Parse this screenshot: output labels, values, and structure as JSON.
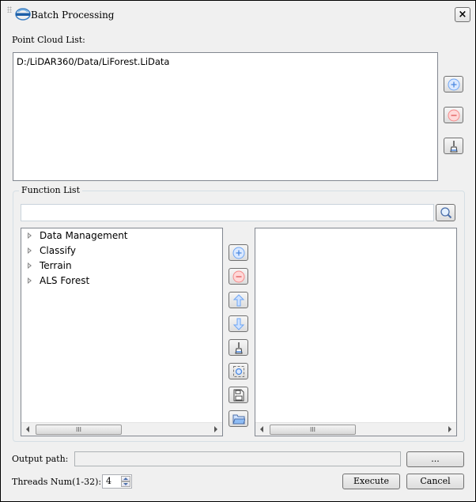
{
  "window": {
    "title": "Batch Processing",
    "close_label": "×"
  },
  "point_cloud": {
    "label": "Point Cloud List:",
    "items": [
      "D:/LiDAR360/Data/LiForest.LiData"
    ]
  },
  "function_list": {
    "label": "Function List",
    "search_placeholder": "",
    "tree": [
      "Data Management",
      "Classify",
      "Terrain",
      "ALS Forest"
    ]
  },
  "scrollbar": {
    "thumb_glyph": "III"
  },
  "output": {
    "label": "Output path:",
    "value": "",
    "browse_label": "..."
  },
  "threads": {
    "label": "Threads Num(1-32):",
    "value": "4"
  },
  "buttons": {
    "execute": "Execute",
    "cancel": "Cancel"
  },
  "colors": {
    "add": "#6ea6f5",
    "remove": "#f58a8a",
    "accent": "#4a90e2"
  }
}
